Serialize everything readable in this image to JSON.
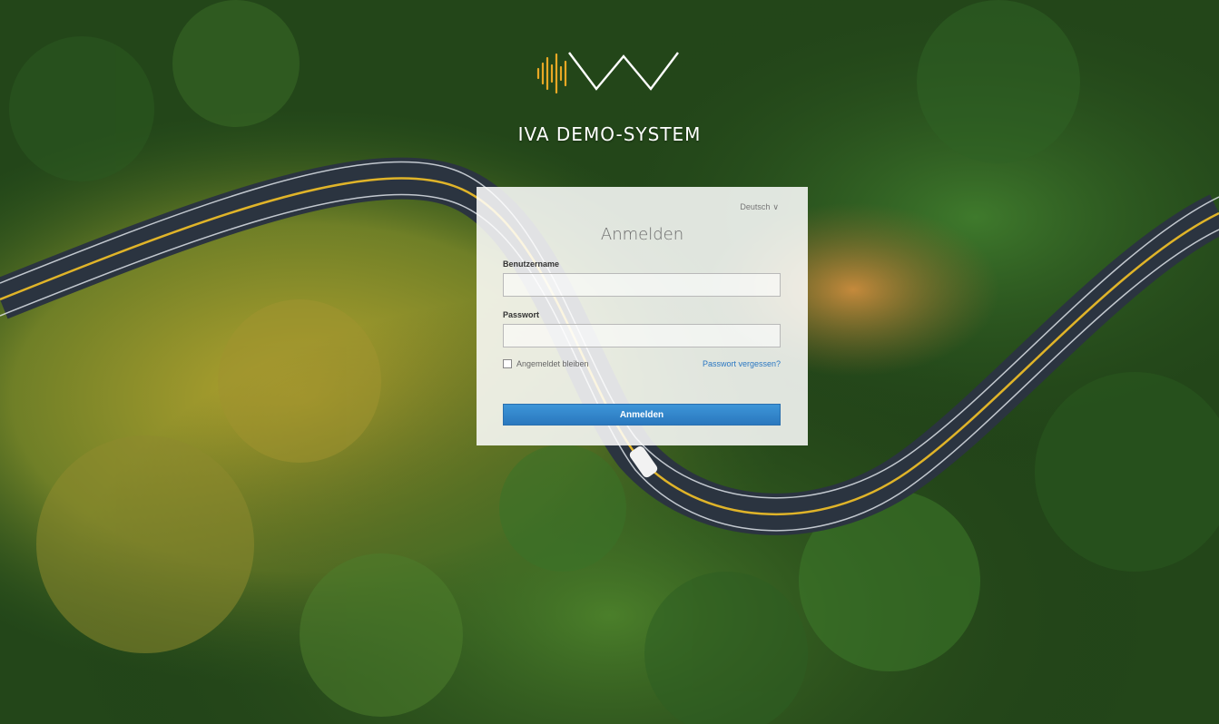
{
  "brand": {
    "title": "IVA DEMO-SYSTEM",
    "logo_icon": "iva-soundwave-logo-icon",
    "accent_color": "#e8a825"
  },
  "login": {
    "language": "Deutsch",
    "language_icon": "chevron-down-icon",
    "title": "Anmelden",
    "username_label": "Benutzername",
    "username_value": "",
    "password_label": "Passwort",
    "password_value": "",
    "remember_label": "Angemeldet bleiben",
    "remember_checked": false,
    "forgot_link": "Passwort vergessen?",
    "submit_label": "Anmelden",
    "button_color": "#2f86cc",
    "link_color": "#2a77c2"
  }
}
